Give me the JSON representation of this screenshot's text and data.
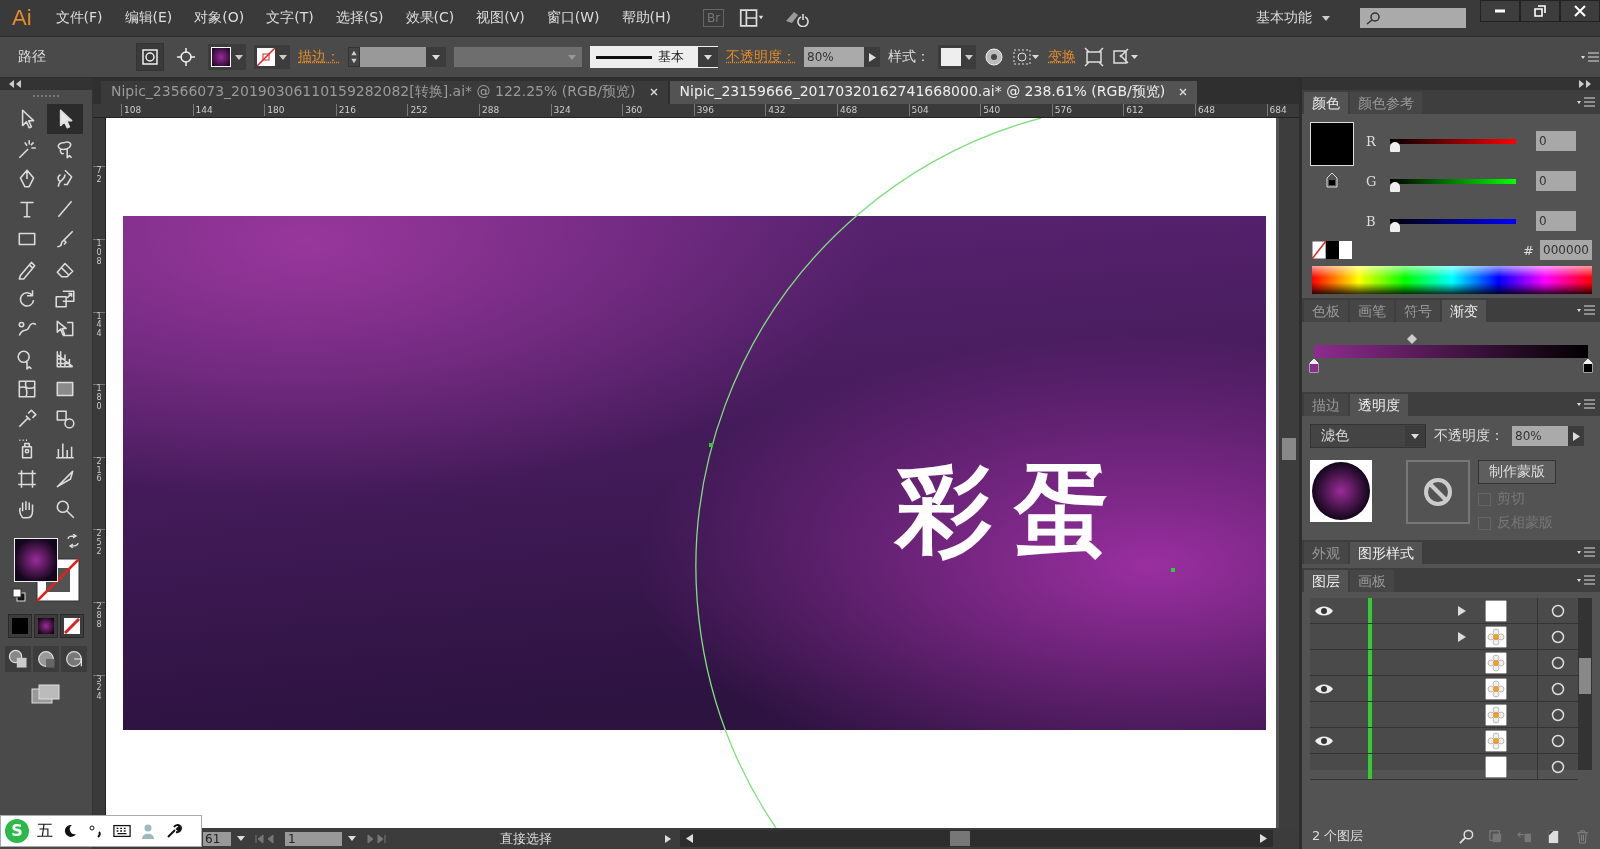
{
  "app": {
    "logo": "Ai",
    "bridge": "Br",
    "workspace": "基本功能"
  },
  "menu": [
    {
      "label": "文件(F)"
    },
    {
      "label": "编辑(E)"
    },
    {
      "label": "对象(O)"
    },
    {
      "label": "文字(T)"
    },
    {
      "label": "选择(S)"
    },
    {
      "label": "效果(C)"
    },
    {
      "label": "视图(V)"
    },
    {
      "label": "窗口(W)"
    },
    {
      "label": "帮助(H)"
    }
  ],
  "control_bar": {
    "object_type": "路径",
    "stroke_label": "描边：",
    "stroke_profile": "基本",
    "opacity_label": "不透明度：",
    "opacity": "80%",
    "style_label": "样式：",
    "transform_label": "变换"
  },
  "document_tabs": [
    {
      "title": "Nipic_23566073_20190306110159282082[转换].ai* @ 122.25% (RGB/预览)",
      "selected": false
    },
    {
      "title": "Nipic_23159666_20170320162741668000.ai* @ 238.61% (RGB/预览)",
      "selected": true
    }
  ],
  "ruler": {
    "horizontal": [
      "108",
      "144",
      "180",
      "216",
      "252",
      "288",
      "324",
      "360",
      "396",
      "432",
      "468",
      "504",
      "540",
      "576",
      "612",
      "648",
      "684"
    ],
    "vertical": [
      "72",
      "108",
      "144",
      "180",
      "216",
      "252",
      "288",
      "324"
    ]
  },
  "tools": [
    {
      "kind": "selection",
      "selected": false
    },
    {
      "kind": "direct-selection",
      "selected": true
    },
    {
      "kind": "magic-wand",
      "selected": false
    },
    {
      "kind": "lasso",
      "selected": false
    },
    {
      "kind": "pen",
      "selected": false
    },
    {
      "kind": "curvature",
      "selected": false
    },
    {
      "kind": "type",
      "selected": false
    },
    {
      "kind": "line",
      "selected": false
    },
    {
      "kind": "rectangle",
      "selected": false
    },
    {
      "kind": "paintbrush",
      "selected": false
    },
    {
      "kind": "pencil",
      "selected": false
    },
    {
      "kind": "eraser",
      "selected": false
    },
    {
      "kind": "rotate",
      "selected": false
    },
    {
      "kind": "scale",
      "selected": false
    },
    {
      "kind": "warp",
      "selected": false
    },
    {
      "kind": "free-transform",
      "selected": false
    },
    {
      "kind": "shape-builder",
      "selected": false
    },
    {
      "kind": "perspective-grid",
      "selected": false
    },
    {
      "kind": "mesh",
      "selected": false
    },
    {
      "kind": "gradient",
      "selected": false
    },
    {
      "kind": "eyedropper",
      "selected": false
    },
    {
      "kind": "blend",
      "selected": false
    },
    {
      "kind": "symbol-sprayer",
      "selected": false
    },
    {
      "kind": "column-graph",
      "selected": false
    },
    {
      "kind": "artboard",
      "selected": false
    },
    {
      "kind": "slice",
      "selected": false
    },
    {
      "kind": "hand",
      "selected": false
    },
    {
      "kind": "zoom",
      "selected": false
    }
  ],
  "artboard": {
    "text": "彩蛋"
  },
  "color_panel": {
    "tabs": [
      {
        "label": "颜色",
        "selected": true
      },
      {
        "label": "颜色参考",
        "selected": false
      }
    ],
    "channels": [
      {
        "name": "R",
        "level": 0,
        "value": "0"
      },
      {
        "name": "G",
        "level": 0,
        "value": "0"
      },
      {
        "name": "B",
        "level": 0,
        "value": "0"
      }
    ],
    "hex_label": "#",
    "hex": "000000"
  },
  "gradient_panel": {
    "tabs": [
      {
        "label": "色板",
        "selected": false
      },
      {
        "label": "画笔",
        "selected": false
      },
      {
        "label": "符号",
        "selected": false
      },
      {
        "label": "渐变",
        "selected": true
      }
    ],
    "stops": [
      {
        "color": "#8e2c8e"
      },
      {
        "color": "#000000"
      }
    ]
  },
  "transparency_panel": {
    "tabs": [
      {
        "label": "描边",
        "selected": false
      },
      {
        "label": "透明度",
        "selected": true
      }
    ],
    "blend_mode": "滤色",
    "opacity_label": "不透明度：",
    "opacity": "80%",
    "mask_button": "制作蒙版",
    "options": [
      {
        "label": "剪切",
        "checked": false,
        "disabled": true
      },
      {
        "label": "反相蒙版",
        "checked": false,
        "disabled": true
      }
    ]
  },
  "appearance_panel": {
    "tabs": [
      {
        "label": "外观",
        "selected": false
      },
      {
        "label": "图形样式",
        "selected": true
      }
    ]
  },
  "layers_panel": {
    "tabs": [
      {
        "label": "图层",
        "selected": true
      },
      {
        "label": "画板",
        "selected": false
      }
    ],
    "rows": [
      {
        "visible": true,
        "expandable": true,
        "kind": "blank"
      },
      {
        "visible": false,
        "expandable": true,
        "kind": "flower"
      },
      {
        "visible": false,
        "expandable": false,
        "kind": "flower"
      },
      {
        "visible": true,
        "expandable": false,
        "kind": "flower"
      },
      {
        "visible": false,
        "expandable": false,
        "kind": "flower"
      },
      {
        "visible": true,
        "expandable": false,
        "kind": "flower"
      },
      {
        "visible": false,
        "expandable": false,
        "kind": "blank"
      }
    ],
    "footer": "2 个图层"
  },
  "status_bar": {
    "zoom": "61",
    "page": "1",
    "tool": "直接选择"
  },
  "ime_bar": {
    "logo": "S",
    "mode": "五"
  }
}
